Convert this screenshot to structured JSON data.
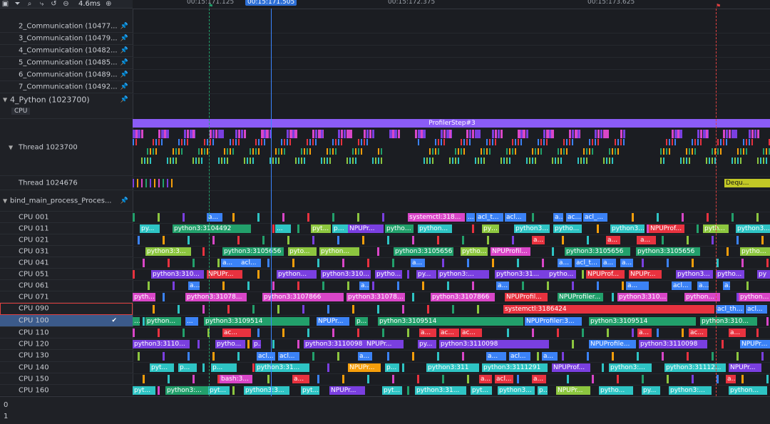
{
  "toolbar": {
    "icons": [
      "panel-icon",
      "filter-icon",
      "search-icon",
      "flow-icon",
      "reset-icon",
      "zoom-out-icon",
      "zoom-in-icon"
    ],
    "zoom_level": "4.6ms"
  },
  "ruler": {
    "labels": [
      "00:15:171.125",
      "00:15:171.505",
      "00:15:172.375",
      "00:15:173.625"
    ]
  },
  "rows": [
    {
      "label": "2_Communication (10477...",
      "pin": true
    },
    {
      "label": "3_Communication (10479...",
      "pin": true
    },
    {
      "label": "4_Communication (10482...",
      "pin": true
    },
    {
      "label": "5_Communication (10485...",
      "pin": true
    },
    {
      "label": "6_Communication (10489...",
      "pin": true
    },
    {
      "label": "7_Communication (10492...",
      "pin": true
    },
    {
      "label": "4_Python (1023700)",
      "pin": true,
      "sub": "CPU"
    },
    {
      "label": "Thread 1023700",
      "pin": false
    },
    {
      "label": "Thread 1024676",
      "pin": false
    },
    {
      "label": "bind_main_process_Proces...",
      "pin": true
    },
    {
      "label": "CPU 001"
    },
    {
      "label": "CPU 011"
    },
    {
      "label": "CPU 021"
    },
    {
      "label": "CPU 031"
    },
    {
      "label": "CPU 041"
    },
    {
      "label": "CPU 051"
    },
    {
      "label": "CPU 061"
    },
    {
      "label": "CPU 071"
    },
    {
      "label": "CPU 090"
    },
    {
      "label": "CPU 100"
    },
    {
      "label": "CPU 110"
    },
    {
      "label": "CPU 120"
    },
    {
      "label": "CPU 130"
    },
    {
      "label": "CPU 140"
    },
    {
      "label": "CPU 150"
    },
    {
      "label": "CPU 160"
    }
  ],
  "tracks": {
    "profiler_step": "ProfilerStep#3",
    "thread_1024676_slice": "Dequ...",
    "cpu_001": [
      "a...",
      "systemctl:318...",
      "...",
      "acl_t...",
      "acl...",
      "a...",
      "ac...",
      "acl_..."
    ],
    "cpu_011": [
      "py...",
      "python3:3104492",
      "...",
      "pyt...",
      "python...",
      "NPUPr...",
      "python3...",
      "python...",
      "pyt...",
      "python3:...",
      "pytho...",
      "python3...",
      "NPUProf...",
      "pyth...",
      "python3..."
    ],
    "cpu_021": [
      "a...",
      "a...",
      "a..."
    ],
    "cpu_031": [
      "python3:3...",
      "python3:3105656",
      "pyto...",
      "python...",
      "python3:3105656",
      "pytho...",
      "NPUProfil...",
      "python3:3105656",
      "python3:3105656",
      "python..."
    ],
    "cpu_041": [
      "a...",
      "acl...",
      "a...",
      "a...",
      "acl_th...",
      "a...",
      "a..."
    ],
    "cpu_051": [
      "python3:310...",
      "NPUPr...",
      "python...",
      "python3:310...",
      "pytho...",
      "py...",
      "python3:...",
      "python3:31...",
      "pytho...",
      "NPUProf...",
      "NPUPr...",
      "python3...",
      "pytho...",
      "py"
    ],
    "cpu_061": [
      "acl...",
      "a...",
      "a...",
      "a...",
      "acl...",
      "a...",
      "a..."
    ],
    "cpu_071": [
      "pyth...",
      "python3:31078...",
      "python3:3107866",
      "python3:3107866",
      "python3:3107866",
      "NPUProfil...",
      "NPUProfiler...",
      "python3:3107...",
      "python...",
      "python3..."
    ],
    "cpu_090": [
      "systemctl:3186424",
      "acl_thr...",
      "acl..."
    ],
    "cpu_100": [
      "...",
      "python...",
      "...",
      "python3:3109514",
      "NPUPr...",
      "p...",
      "python3:3109514",
      "NPUProfiler:3...",
      "python3:3109514",
      "python3:310..."
    ],
    "cpu_110": [
      "ac...",
      "a...",
      "ac...",
      "ac...",
      "a...",
      "ac...",
      "a..."
    ],
    "cpu_120": [
      "python3:3110...",
      "pytho...",
      "p...",
      "python3:3110098",
      "NPUPr...",
      "py...",
      "python3:3110098",
      "NPUProfile...",
      "python3:3110098",
      "NPUPro..."
    ],
    "cpu_130": [
      "acl...",
      "acl...",
      "a...",
      "a...",
      "acl...",
      "a..."
    ],
    "cpu_140": [
      "pyt...",
      "p...",
      "p...",
      "python3:31...",
      "NPUPr...",
      "p...",
      "python3:311",
      "python3:3111291",
      "NPUProf...",
      "python3:...",
      "python3:31112...",
      "NPUPr..."
    ],
    "cpu_150": [
      "bash:3...",
      "a...",
      "a...",
      "acl...",
      "a...",
      "a..."
    ],
    "cpu_160": [
      "pyt...",
      "python3:...",
      "pyt...",
      "python3:3...",
      "pyt...",
      "NPUPr...",
      "pyt...",
      "python3:31...",
      "pyt...",
      "python3...",
      "p...",
      "NPUPr...",
      "pytho...",
      "py...",
      "python3:...",
      "python..."
    ]
  },
  "bottom": {
    "values": [
      "0",
      "1"
    ]
  },
  "colors": {
    "python": "#7a3fe0",
    "npu": "#e8323f",
    "acl": "#3b82f6",
    "green": "#22a06b",
    "teal": "#2ec4c4",
    "lime": "#8cc63f",
    "pink": "#d946c8",
    "orange": "#f59e0b",
    "selected_row": "#e04040",
    "cursor_line": "#3a86ff"
  }
}
